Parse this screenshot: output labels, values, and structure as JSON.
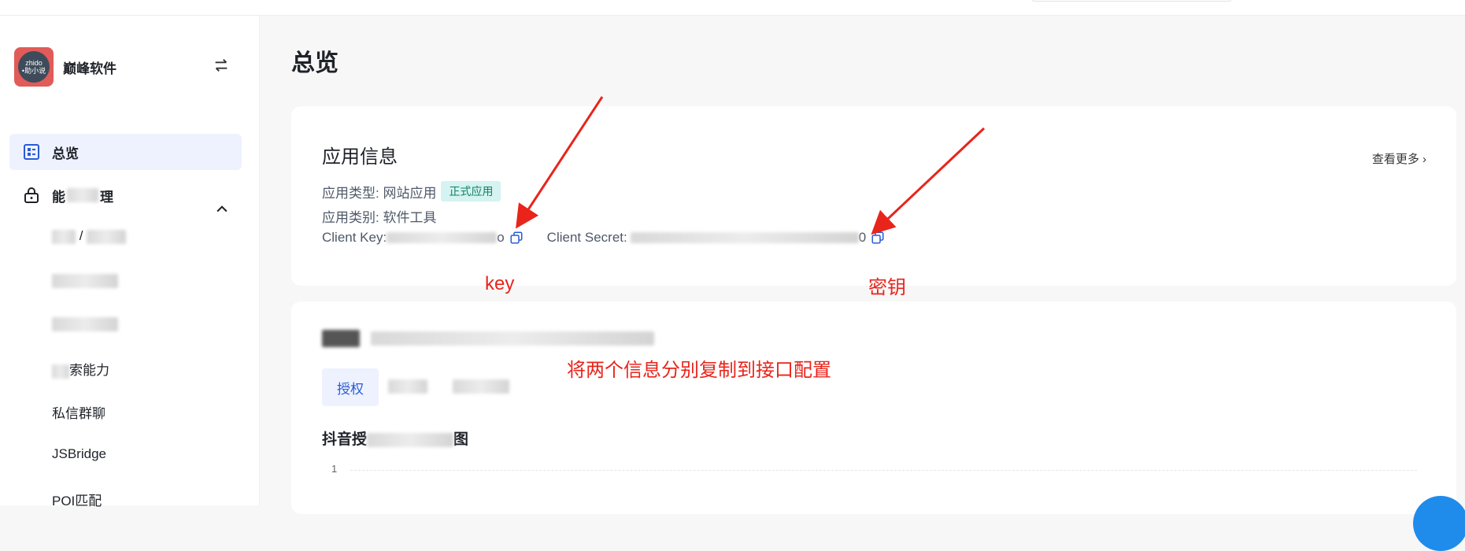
{
  "sidebar": {
    "brand": {
      "logo_text": "zhido",
      "logo_subtext": "•助小说",
      "name": "巅峰软件"
    },
    "items": [
      {
        "label": "总览",
        "active": true
      },
      {
        "label": "能",
        "suffix": "理",
        "expanded": true
      },
      {
        "label": "/"
      },
      {
        "label": ""
      },
      {
        "label": ""
      },
      {
        "label": "索能力"
      },
      {
        "label": "私信群聊"
      },
      {
        "label": "JSBridge"
      },
      {
        "label": "POI匹配"
      }
    ]
  },
  "main": {
    "page_title": "总览",
    "app_info": {
      "title": "应用信息",
      "see_more": "查看更多 ›",
      "type_label": "应用类型: 网站应用",
      "type_badge": "正式应用",
      "category_label": "应用类别: 软件工具",
      "client_key_label": "Client Key:",
      "client_key_tail": "o",
      "client_secret_label": "Client Secret:",
      "client_secret_tail": "0"
    },
    "annotations": {
      "key": "key",
      "secret": "密钥",
      "instruction": "将两个信息分别复制到接口配置"
    },
    "data_section": {
      "tab_authorize": "授权",
      "chart_title_prefix": "抖音授",
      "chart_title_suffix": "图",
      "axis_tick": "1"
    }
  },
  "colors": {
    "accent": "#2a5bd7",
    "annotation": "#e8241b",
    "badge_bg": "#d5f3f0"
  }
}
